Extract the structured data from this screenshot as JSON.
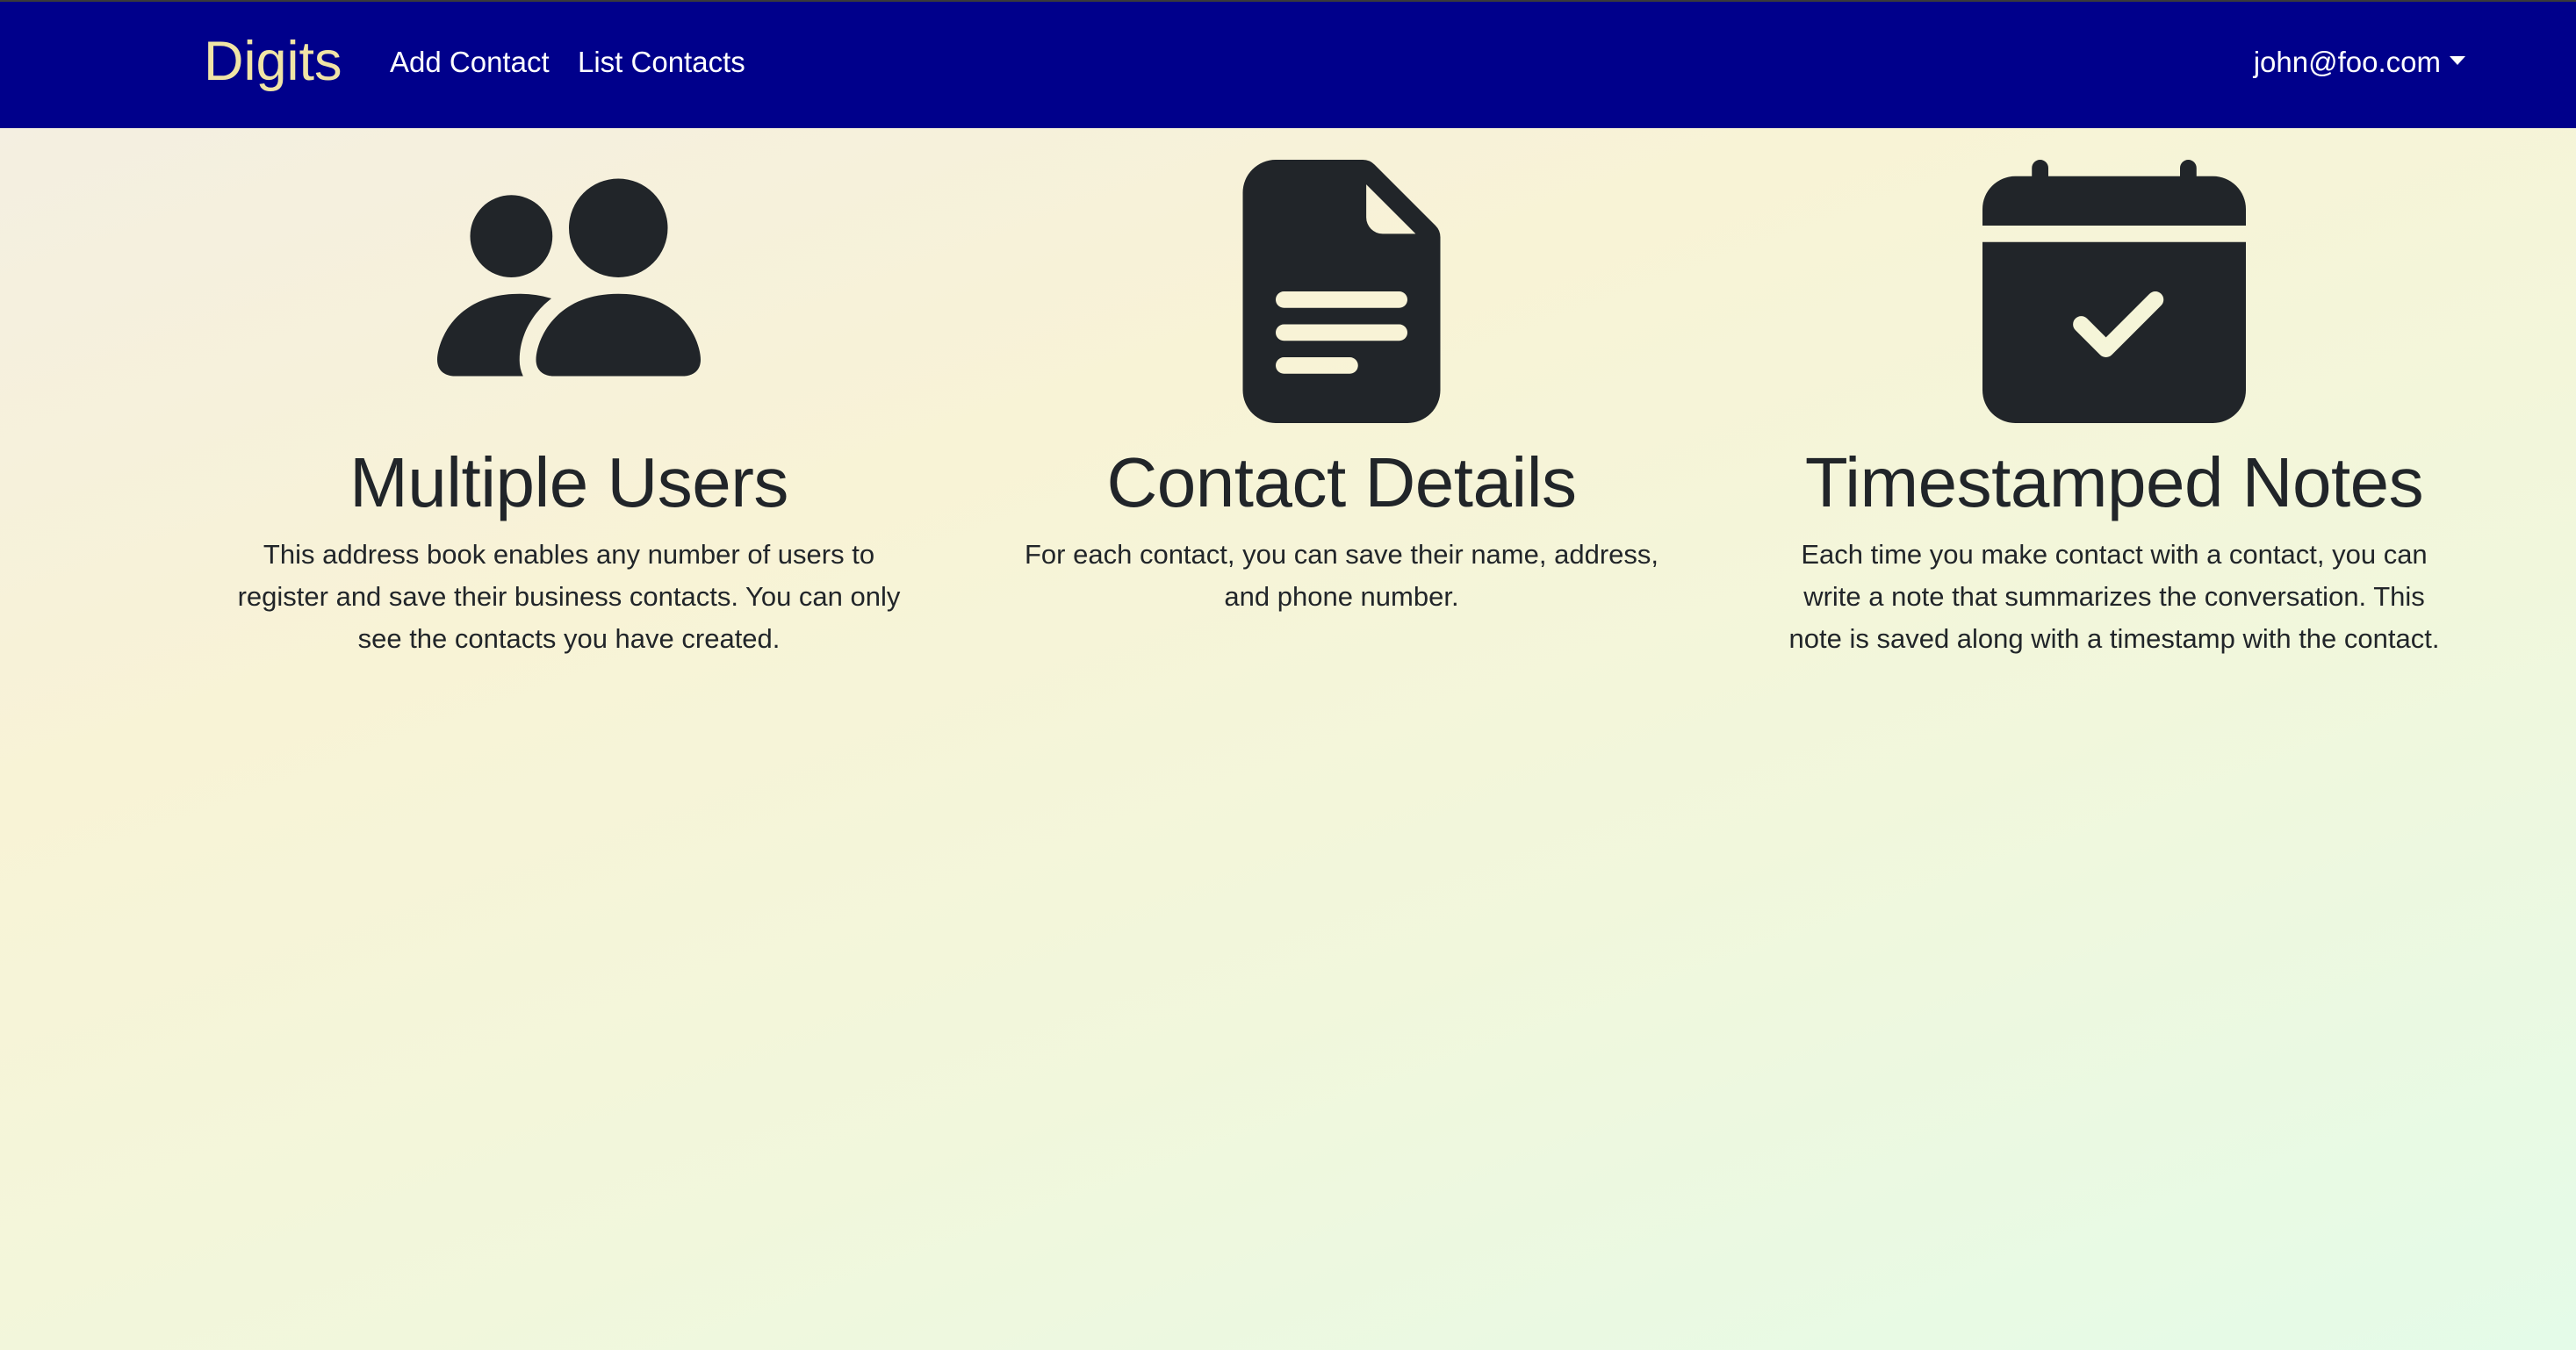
{
  "navbar": {
    "brand": "Digits",
    "links": [
      {
        "label": "Add Contact"
      },
      {
        "label": "List Contacts"
      }
    ],
    "user": "john@foo.com",
    "background_color": "#00008b",
    "brand_color": "#f0e4a6"
  },
  "features": [
    {
      "icon": "people-fill-icon",
      "title": "Multiple Users",
      "description": "This address book enables any number of users to register and save their business contacts. You can only see the contacts you have created."
    },
    {
      "icon": "file-text-fill-icon",
      "title": "Contact Details",
      "description": "For each contact, you can save their name, address, and phone number."
    },
    {
      "icon": "calendar-check-fill-icon",
      "title": "Timestamped Notes",
      "description": "Each time you make contact with a contact, you can write a note that summarizes the conversation. This note is saved along with a timestamp with the contact."
    }
  ],
  "colors": {
    "icon": "#212529",
    "text": "#212529"
  }
}
